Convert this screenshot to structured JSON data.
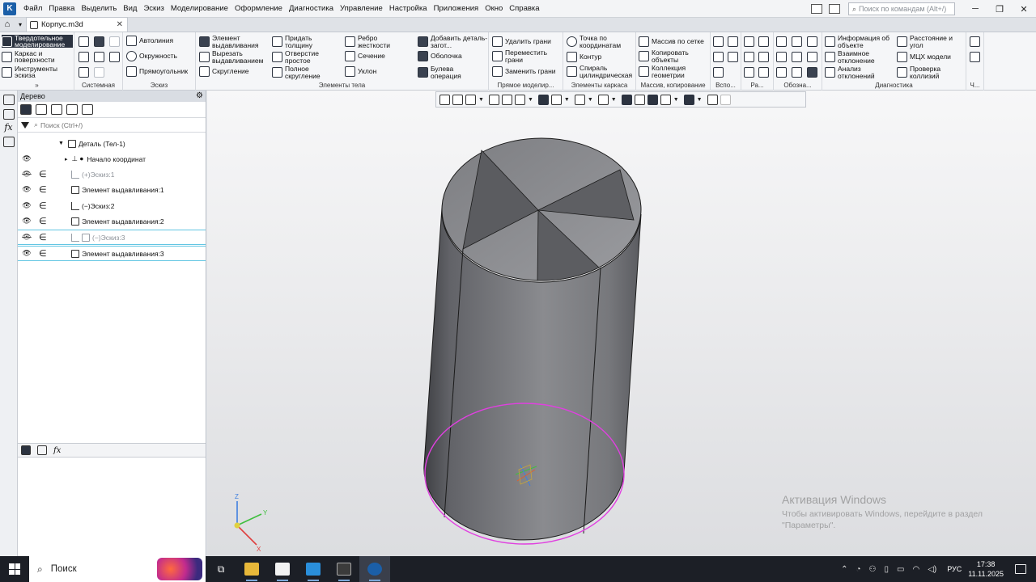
{
  "menubar": {
    "items": [
      "Файл",
      "Правка",
      "Выделить",
      "Вид",
      "Эскиз",
      "Моделирование",
      "Оформление",
      "Диагностика",
      "Управление",
      "Настройка",
      "Приложения",
      "Окно",
      "Справка"
    ],
    "search_placeholder": "Поиск по командам (Alt+/)"
  },
  "tabs": {
    "document": "Корпус.m3d"
  },
  "ribbon": {
    "left_modes": [
      "Твердотельное моделирование",
      "Каркас и поверхности",
      "Инструменты эскиза"
    ],
    "sketch": [
      "Автолиния",
      "Окружность",
      "Прямоугольник"
    ],
    "body_col1": [
      "Элемент выдавливания",
      "Вырезать выдавливанием",
      "Скругление"
    ],
    "body_col2": [
      "Придать толщину",
      "Отверстие простое",
      "Полное скругление"
    ],
    "body_col3": [
      "Ребро жесткости",
      "Сечение",
      "Уклон"
    ],
    "body_col4": [
      "Добавить деталь-загот...",
      "Оболочка",
      "Булева операция"
    ],
    "direct": [
      "Удалить грани",
      "Переместить грани",
      "Заменить грани"
    ],
    "frame": [
      "Точка по координатам",
      "Контур",
      "Спираль цилиндрическая"
    ],
    "array": [
      "Массив по сетке",
      "Копировать объекты",
      "Коллекция геометрии"
    ],
    "diag_col1": [
      "Информация об объекте",
      "Взаимное отклонение",
      "Анализ отклонений"
    ],
    "diag_col2": [
      "Расстояние и угол",
      "МЦХ модели",
      "Проверка коллизий"
    ],
    "group_titles": [
      "Системная",
      "Эскиз",
      "Элементы тела",
      "Прямое моделир...",
      "Элементы каркаса",
      "Массив, копирование",
      "Вспо...",
      "Ра...",
      "Обозна...",
      "Диагностика",
      "Ч..."
    ]
  },
  "tree": {
    "title": "Дерево",
    "search_placeholder": "Поиск (Ctrl+/)",
    "rows": [
      {
        "text": "Деталь (Тел-1)"
      },
      {
        "text": "Начало координат"
      },
      {
        "text": "(+)Эскиз:1"
      },
      {
        "text": "Элемент выдавливания:1"
      },
      {
        "text": "(−)Эскиз:2"
      },
      {
        "text": "Элемент выдавливания:2"
      },
      {
        "text": "(−)Эскиз:3"
      },
      {
        "text": "Элемент выдавливания:3"
      }
    ]
  },
  "viewport": {
    "axis_labels": {
      "z": "Z",
      "y": "Y",
      "x": "X"
    },
    "activation_title": "Активация Windows",
    "activation_subtitle": "Чтобы активировать Windows, перейдите в раздел \"Параметры\"."
  },
  "taskbar": {
    "search_label": "Поиск",
    "language": "РУС",
    "time": "17:38",
    "date": "11.11.2025"
  },
  "colors": {
    "accent_dark": "#2c3340",
    "selection_outline": "#e040e0",
    "tree_selection": "#63c6e3"
  }
}
